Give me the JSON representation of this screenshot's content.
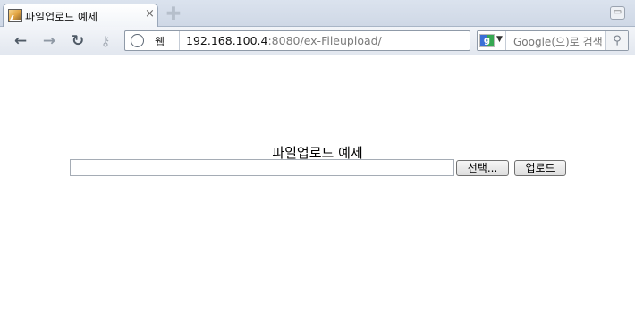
{
  "browser": {
    "tab": {
      "title": "파일업로드 예제",
      "close_glyph": "×"
    },
    "new_tab_glyph": "✚",
    "window_button_glyph": "▭",
    "toolbar": {
      "back_glyph": "←",
      "forward_glyph": "→",
      "reload_glyph": "↻",
      "key_glyph": "⚷"
    },
    "address": {
      "label": "웹",
      "url_host": "192.168.100.4",
      "url_rest": ":8080/ex-Fileupload/"
    },
    "search": {
      "engine_letter": "g",
      "dropdown_glyph": "▼",
      "placeholder": "Google(으)로 검색",
      "button_glyph": "⚲"
    }
  },
  "page": {
    "heading": "파일업로드 예제",
    "file_input_value": "",
    "browse_label": "선택...",
    "upload_label": "업로드"
  }
}
